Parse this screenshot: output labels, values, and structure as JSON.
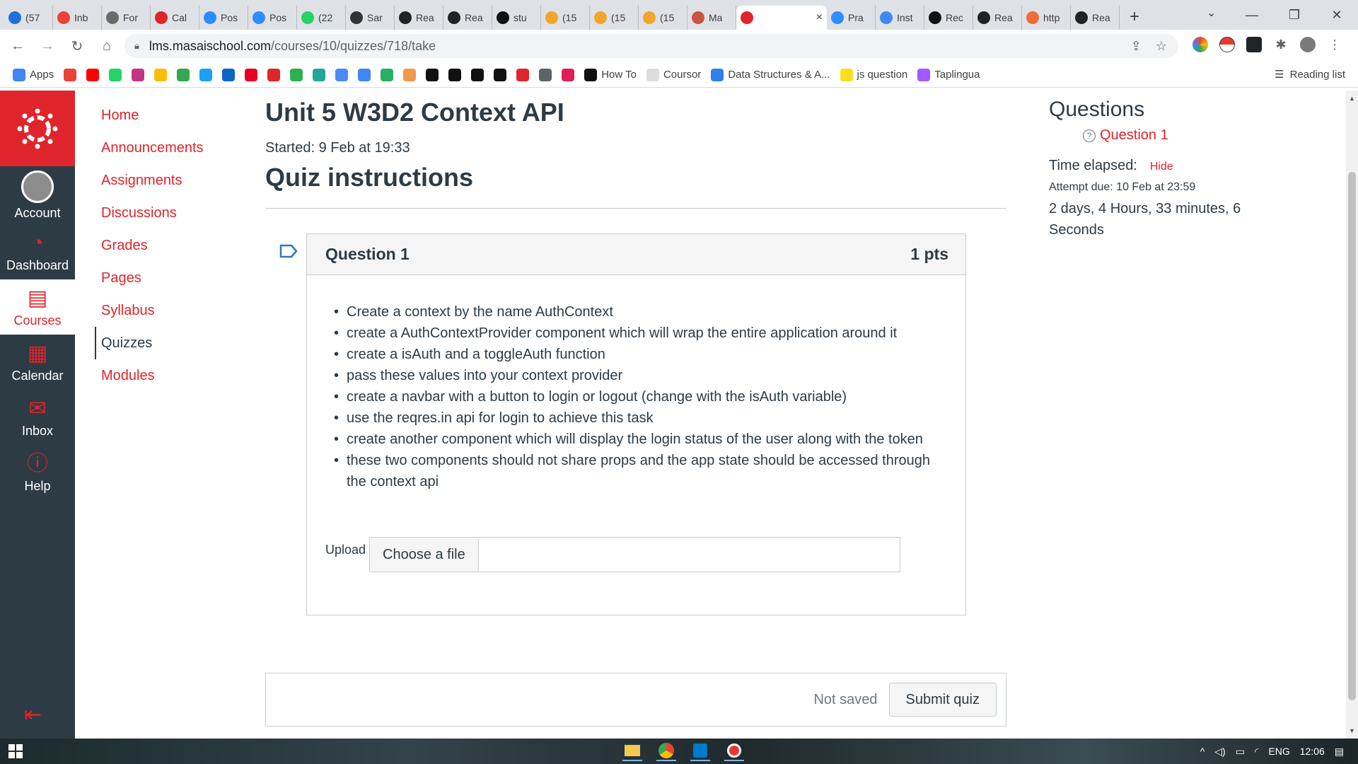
{
  "browser": {
    "tabs": [
      {
        "label": "(57",
        "color": "#1f6fd6"
      },
      {
        "label": "Inb",
        "color": "#ea4335"
      },
      {
        "label": "For",
        "color": "#6b6b6b"
      },
      {
        "label": "Cal",
        "color": "#e0242b"
      },
      {
        "label": "Pos",
        "color": "#2d8cff"
      },
      {
        "label": "Pos",
        "color": "#2d8cff"
      },
      {
        "label": "(22",
        "color": "#25d366"
      },
      {
        "label": "Sar",
        "color": "#333333"
      },
      {
        "label": "Rea",
        "color": "#222222"
      },
      {
        "label": "Rea",
        "color": "#222222"
      },
      {
        "label": "stu",
        "color": "#111111"
      },
      {
        "label": "(15",
        "color": "#f2a52b"
      },
      {
        "label": "(15",
        "color": "#f2a52b"
      },
      {
        "label": "(15",
        "color": "#f2a52b"
      },
      {
        "label": "Ma",
        "color": "#c8553d"
      },
      {
        "label": "",
        "color": "#e0242b",
        "active": true
      },
      {
        "label": "Pra",
        "color": "#2d8cff"
      },
      {
        "label": "Inst",
        "color": "#3f88f5"
      },
      {
        "label": "Rec",
        "color": "#111111"
      },
      {
        "label": "Rea",
        "color": "#222222"
      },
      {
        "label": "http",
        "color": "#f26b3a"
      },
      {
        "label": "Rea",
        "color": "#222222"
      }
    ],
    "active_tab_close": "×",
    "new_tab": "+",
    "url_host": "lms.masaischool.com",
    "url_path": "/courses/10/quizzes/718/take",
    "bookmarks": [
      {
        "label": "Apps",
        "color": "#4285f4"
      },
      {
        "label": "",
        "color": "#ea4335"
      },
      {
        "label": "",
        "color": "#ff0000"
      },
      {
        "label": "",
        "color": "#25d366"
      },
      {
        "label": "",
        "color": "#c13584"
      },
      {
        "label": "",
        "color": "#fbbc04"
      },
      {
        "label": "",
        "color": "#34a853"
      },
      {
        "label": "",
        "color": "#1da1f2"
      },
      {
        "label": "",
        "color": "#0a66c2"
      },
      {
        "label": "",
        "color": "#e60023"
      },
      {
        "label": "",
        "color": "#e0242b"
      },
      {
        "label": "",
        "color": "#2bb24c"
      },
      {
        "label": "",
        "color": "#22a699"
      },
      {
        "label": "",
        "color": "#4c8bf5"
      },
      {
        "label": "",
        "color": "#3f88f5"
      },
      {
        "label": "",
        "color": "#27ae60"
      },
      {
        "label": "",
        "color": "#f2994a"
      },
      {
        "label": "",
        "color": "#111111"
      },
      {
        "label": "",
        "color": "#111111"
      },
      {
        "label": "",
        "color": "#111111"
      },
      {
        "label": "",
        "color": "#111111"
      },
      {
        "label": "",
        "color": "#e0242b"
      },
      {
        "label": "",
        "color": "#5f6368"
      },
      {
        "label": "",
        "color": "#e01e5a"
      },
      {
        "label": "How To",
        "color": "#111111"
      },
      {
        "label": "Coursor",
        "color": "#dddddd"
      },
      {
        "label": "Data Structures & A...",
        "color": "#2f80ed"
      },
      {
        "label": "js question",
        "color": "#f7df1e"
      },
      {
        "label": "Taplingua",
        "color": "#a259ff"
      }
    ],
    "reading_list": "Reading list"
  },
  "global_nav": {
    "items": [
      {
        "label": "Account",
        "icon": "account-icon"
      },
      {
        "label": "Dashboard",
        "icon": "dashboard-icon"
      },
      {
        "label": "Courses",
        "icon": "courses-icon",
        "active": true
      },
      {
        "label": "Calendar",
        "icon": "calendar-icon"
      },
      {
        "label": "Inbox",
        "icon": "inbox-icon"
      },
      {
        "label": "Help",
        "icon": "help-icon"
      }
    ]
  },
  "course_nav": {
    "items": [
      "Home",
      "Announcements",
      "Assignments",
      "Discussions",
      "Grades",
      "Pages",
      "Syllabus",
      "Quizzes",
      "Modules"
    ],
    "active": "Quizzes"
  },
  "quiz": {
    "title": "Unit 5 W3D2 Context API",
    "started": "Started: 9 Feb at 19:33",
    "instructions_heading": "Quiz instructions",
    "question": {
      "name": "Question 1",
      "points": "1 pts",
      "bullets": [
        "Create a context by the name AuthContext",
        "create a AuthContextProvider component which will wrap the entire application around it",
        "create a isAuth and a toggleAuth function",
        "pass these values into your context provider",
        "create a navbar with a button to login or logout (change with the isAuth variable)",
        "use the reqres.in api for login to achieve this task",
        "create another component which will display the login status of the user along with the token",
        "these two components should not share props and the app state should be accessed through the context api"
      ],
      "upload_label": "Upload",
      "choose_file": "Choose a file"
    },
    "status": "Not saved",
    "submit": "Submit quiz"
  },
  "sidebar": {
    "title": "Questions",
    "question_link": "Question 1",
    "time_elapsed_label": "Time elapsed:",
    "hide": "Hide",
    "attempt_due": "Attempt due: 10 Feb at 23:59",
    "time_value": "2 days, 4 Hours, 33 minutes, 6 Seconds"
  },
  "taskbar": {
    "language": "ENG",
    "time": "12:06"
  },
  "colors": {
    "brand": "#e0242b",
    "nav_bg": "#2d3b45"
  }
}
